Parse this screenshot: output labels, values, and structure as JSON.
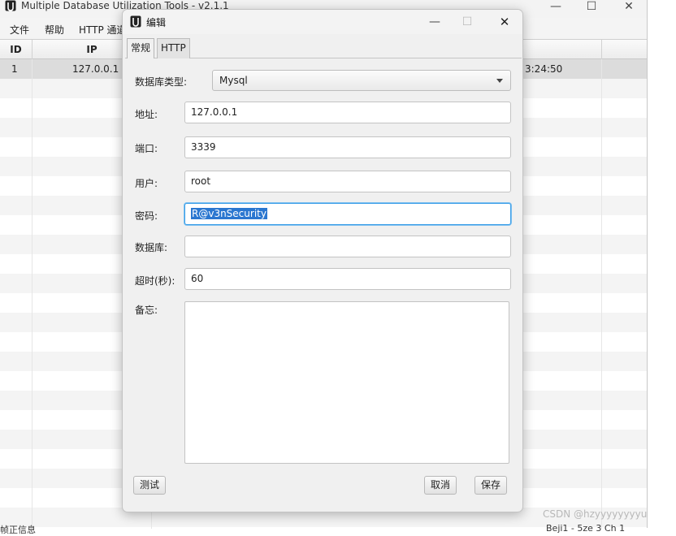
{
  "main": {
    "title": "Multiple Database Utilization Tools - v2.1.1",
    "menu": [
      "文件",
      "帮助",
      "HTTP 通道"
    ],
    "columns": [
      "ID",
      "IP"
    ],
    "row1": {
      "id": "1",
      "ip": "127.0.0.1",
      "time": "3:24:50"
    },
    "status_left": "帧正信息",
    "status_right": "Beji1 - 5ze  3  Ch 1"
  },
  "watermark": "CSDN @hzyyyyyyyyu",
  "dialog": {
    "title": "编辑",
    "tabs": [
      "常规",
      "HTTP"
    ],
    "db_type_label": "数据库类型:",
    "db_type_value": "Mysql",
    "address_label": "地址:",
    "address_value": "127.0.0.1",
    "port_label": "端口:",
    "port_value": "3339",
    "user_label": "用户:",
    "user_value": "root",
    "password_label": "密码:",
    "password_value": "R@v3nSecurity",
    "database_label": "数据库:",
    "database_value": "",
    "timeout_label": "超时(秒):",
    "timeout_value": "60",
    "remark_label": "备忘:",
    "remark_value": "",
    "test_button": "测试",
    "cancel_button": "取消",
    "save_button": "保存"
  },
  "icons": {
    "minimize": "minimize-icon",
    "maximize": "maximize-icon",
    "close": "close-icon",
    "dropdown": "chevron-down-icon"
  },
  "colors": {
    "selection": "#2b77d0",
    "focus_border": "#3d9fe8"
  }
}
